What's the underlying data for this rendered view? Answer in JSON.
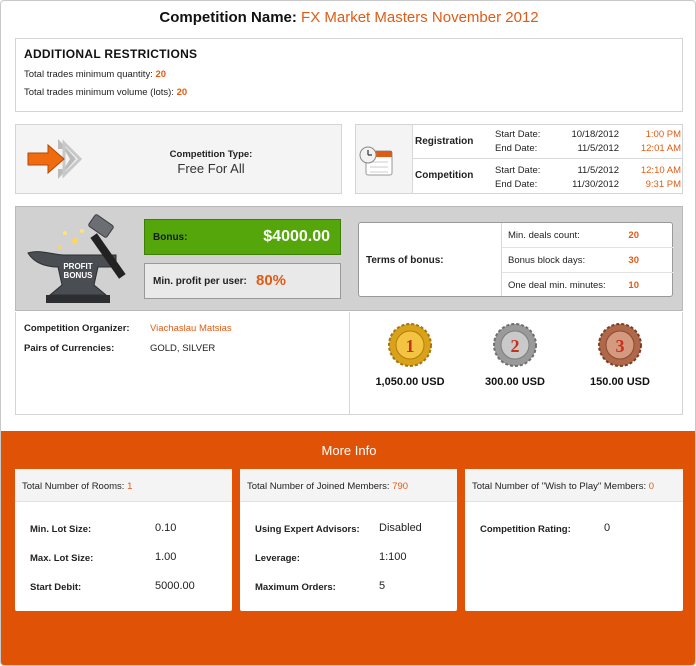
{
  "title": {
    "label": "Competition Name:",
    "value": "FX Market Masters November 2012"
  },
  "restrictions": {
    "heading": "ADDITIONAL RESTRICTIONS",
    "min_qty_label": "Total trades minimum quantity:",
    "min_qty_value": "20",
    "min_vol_label": "Total trades minimum volume (lots):",
    "min_vol_value": "20"
  },
  "competition_type": {
    "label": "Competition Type:",
    "value": "Free For All",
    "icon": "arrow-right-icon"
  },
  "schedule": {
    "icon": "calendar-clock-icon",
    "registration": {
      "label": "Registration",
      "start_label": "Start Date:",
      "start_date": "10/18/2012",
      "start_time": "1:00 PM",
      "end_label": "End Date:",
      "end_date": "11/5/2012",
      "end_time": "12:01 AM"
    },
    "competition": {
      "label": "Competition",
      "start_label": "Start Date:",
      "start_date": "11/5/2012",
      "start_time": "12:10 AM",
      "end_label": "End Date:",
      "end_date": "11/30/2012",
      "end_time": "9:31 PM"
    }
  },
  "bonus": {
    "image_icon": "anvil-hammer-profit-bonus-icon",
    "image_text": "PROFIT BONUS",
    "bonus_label": "Bonus:",
    "bonus_value": "$4000.00",
    "min_profit_label": "Min. profit per user:",
    "min_profit_value": "80%",
    "terms_label": "Terms of bonus:",
    "terms": [
      {
        "label": "Min. deals count:",
        "value": "20"
      },
      {
        "label": "Bonus block days:",
        "value": "30"
      },
      {
        "label": "One deal min. minutes:",
        "value": "10"
      }
    ]
  },
  "organizer": {
    "organizer_label": "Competition Organizer:",
    "organizer_value": "Viachaslau Matsias",
    "pairs_label": "Pairs of Currencies:",
    "pairs_value": "GOLD, SILVER"
  },
  "prizes": [
    {
      "place": "1",
      "amount": "1,050.00 USD",
      "color": "#d9a21b",
      "icon": "gold-medal-icon"
    },
    {
      "place": "2",
      "amount": "300.00 USD",
      "color": "#9a9a9a",
      "icon": "silver-medal-icon"
    },
    {
      "place": "3",
      "amount": "150.00 USD",
      "color": "#b0684a",
      "icon": "bronze-medal-icon"
    }
  ],
  "more_info": {
    "title": "More Info",
    "rooms_label": "Total Number of Rooms:",
    "rooms_value": "1",
    "joined_label": "Total Number of Joined Members:",
    "joined_value": "790",
    "wish_label": "Total Number of \"Wish to Play\" Members:",
    "wish_value": "0",
    "min_lot_label": "Min. Lot Size:",
    "min_lot_value": "0.10",
    "max_lot_label": "Max. Lot Size:",
    "max_lot_value": "1.00",
    "start_debit_label": "Start Debit:",
    "start_debit_value": "5000.00",
    "ea_label": "Using Expert Advisors:",
    "ea_value": "Disabled",
    "leverage_label": "Leverage:",
    "leverage_value": "1:100",
    "max_orders_label": "Maximum Orders:",
    "max_orders_value": "5",
    "rating_label": "Competition Rating:",
    "rating_value": "0"
  },
  "colors": {
    "accent": "#e05c16",
    "bonus_green": "#54a60a",
    "more_info_bg": "#e05307"
  }
}
